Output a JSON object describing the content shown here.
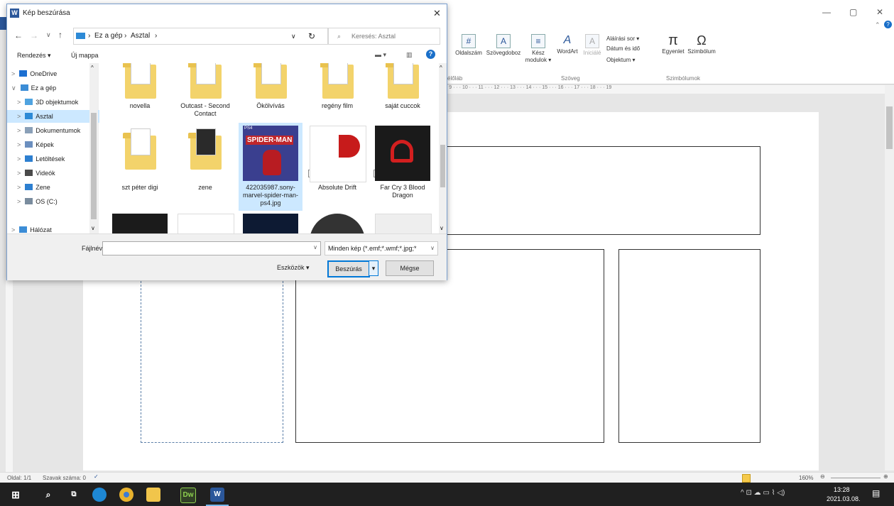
{
  "word": {
    "window_controls": [
      "—",
      "▢",
      "✕"
    ],
    "ribbon": {
      "buttons": [
        {
          "label": "Oldalszám",
          "icon": "page-number-icon"
        },
        {
          "label": "Szövegdoboz",
          "icon": "textbox-icon"
        },
        {
          "label": "Kész modulok ▾",
          "icon": "quick-parts-icon"
        },
        {
          "label": "WordArt",
          "icon": "wordart-icon"
        },
        {
          "label": "Iniciálé",
          "icon": "dropcap-icon"
        }
      ],
      "small_buttons": [
        "Aláírási sor ▾",
        "Dátum és idő",
        "Objektum ▾"
      ],
      "symbol_buttons": [
        {
          "label": "Egyenlet",
          "glyph": "π"
        },
        {
          "label": "Szimbólum",
          "glyph": "Ω"
        }
      ],
      "group_labels": {
        "header": "élőláb",
        "text": "Szöveg",
        "symbols": "Szimbólumok"
      }
    },
    "ruler_text": "· 9 · · · 10 · · · 11 · · · 12 · · · 13 · · · 14 · · · 15 · · · 16 · · · 17 · · · 18 · · · 19",
    "status": {
      "page": "Oldal: 1/1",
      "words": "Szavak száma: 0",
      "zoom": "160%"
    }
  },
  "taskbar": {
    "time": "13:28",
    "date": "2021.03.08.",
    "apps": [
      "windows-start-icon",
      "search-icon",
      "task-view-icon",
      "edge-icon",
      "chrome-icon",
      "file-explorer-icon",
      "dreamweaver-icon",
      "word-icon"
    ],
    "dw_label": "Dw",
    "word_label": "W"
  },
  "dialog": {
    "title": "Kép beszúrása",
    "breadcrumb": [
      "Ez a gép",
      "Asztal"
    ],
    "search_placeholder": "Keresés: Asztal",
    "organize": "Rendezés ▾",
    "new_folder": "Új mappa",
    "nav": [
      {
        "label": "OneDrive",
        "icon": "cloud-icon",
        "indent": 1,
        "expander": ">"
      },
      {
        "label": "Ez a gép",
        "icon": "computer-icon",
        "indent": 1,
        "expander": "∨"
      },
      {
        "label": "3D objektumok",
        "icon": "3d-objects-icon",
        "indent": 2,
        "expander": ">"
      },
      {
        "label": "Asztal",
        "icon": "desktop-icon",
        "indent": 2,
        "expander": ">",
        "selected": true
      },
      {
        "label": "Dokumentumok",
        "icon": "documents-icon",
        "indent": 2,
        "expander": ">"
      },
      {
        "label": "Képek",
        "icon": "pictures-icon",
        "indent": 2,
        "expander": ">"
      },
      {
        "label": "Letöltések",
        "icon": "downloads-icon",
        "indent": 2,
        "expander": ">"
      },
      {
        "label": "Videók",
        "icon": "videos-icon",
        "indent": 2,
        "expander": ">"
      },
      {
        "label": "Zene",
        "icon": "music-icon",
        "indent": 2,
        "expander": ">"
      },
      {
        "label": "OS (C:)",
        "icon": "drive-icon",
        "indent": 2,
        "expander": ">"
      },
      {
        "label": "Hálózat",
        "icon": "network-icon",
        "indent": 1,
        "expander": ">"
      }
    ],
    "files_row1": [
      "novella",
      "Outcast - Second Contact",
      "Ökölvívás",
      "regény film",
      "saját cuccok"
    ],
    "files_row2": [
      "szt péter digi",
      "zene",
      "422035987.sony-marvel-spider-man-ps4.jpg",
      "Absolute Drift",
      "Far Cry 3 Blood Dragon"
    ],
    "spiderman_cover": {
      "platform": "PS4",
      "title": "SPIDER-MAN"
    },
    "filename_label": "Fájlnév:",
    "filename_value": "",
    "filter": "Minden kép (*.emf;*.wmf;*.jpg;*",
    "tools": "Eszközök ▾",
    "insert": "Beszúrás",
    "cancel": "Mégse",
    "colors": {
      "selected": "#cce8ff",
      "accent": "#0078d7",
      "folder": "#f3d36b"
    }
  }
}
